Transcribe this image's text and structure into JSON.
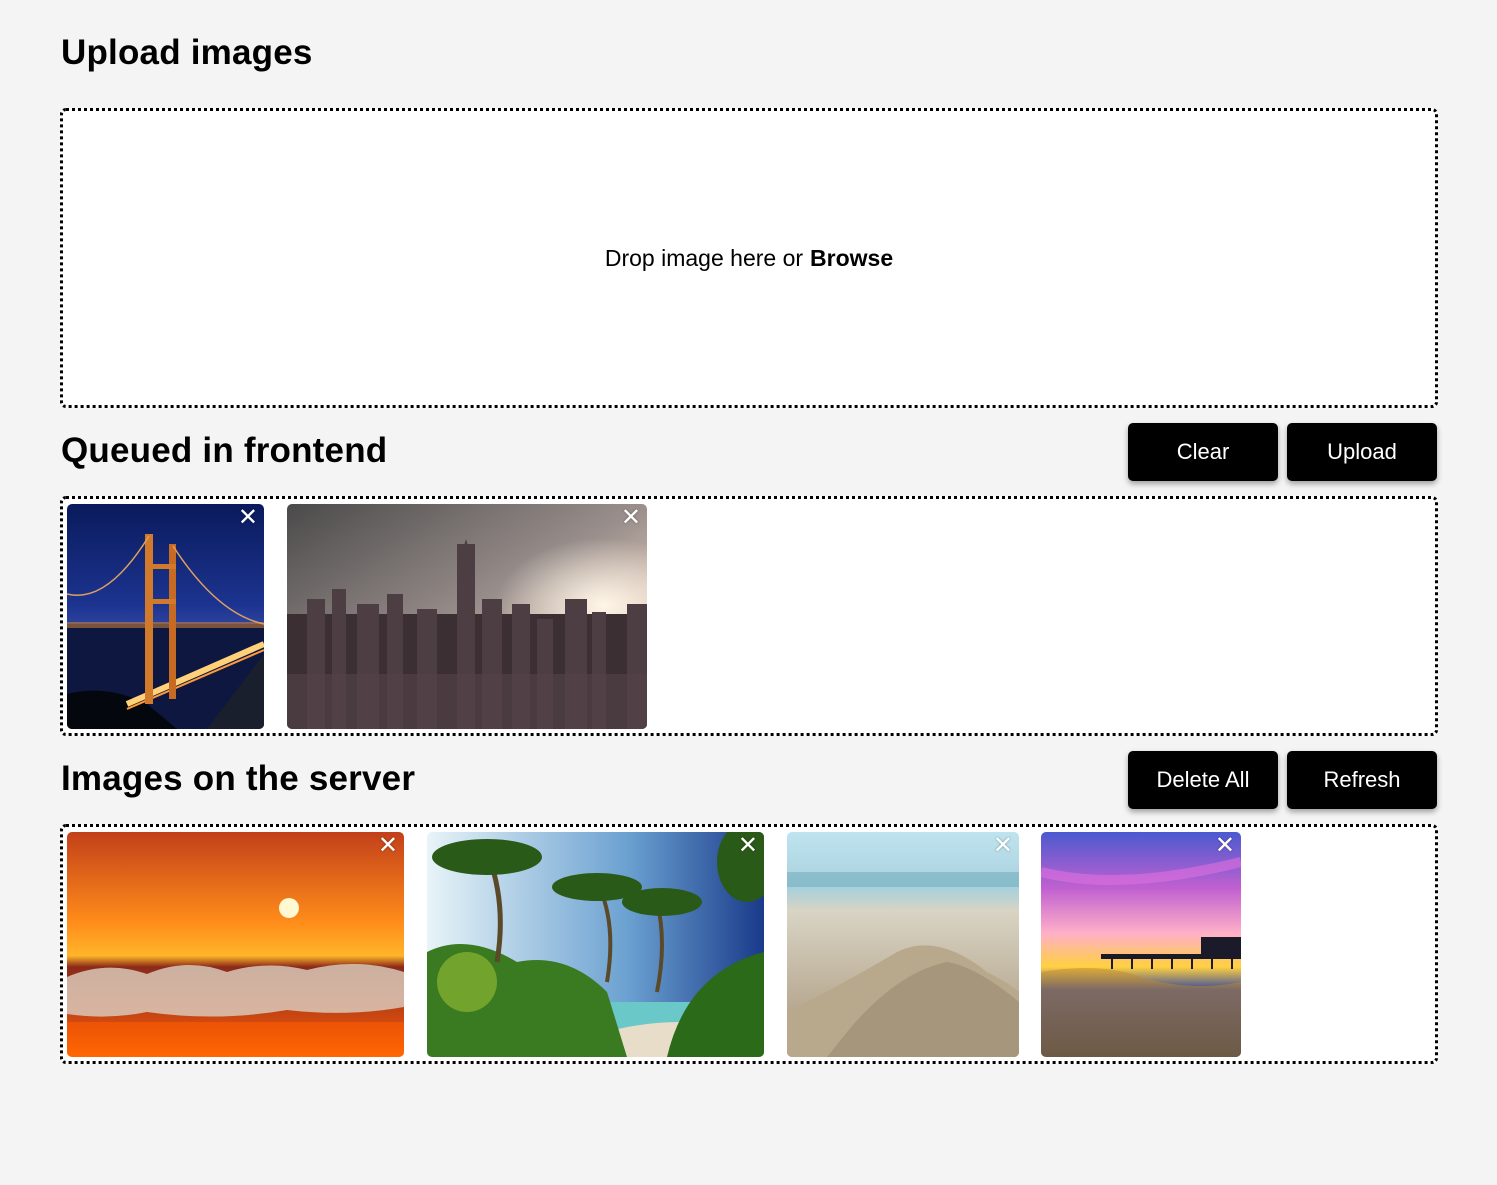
{
  "upload": {
    "title": "Upload images",
    "drop_text": "Drop image here or",
    "browse_label": "Browse"
  },
  "queued": {
    "title": "Queued in frontend",
    "clear_label": "Clear",
    "upload_label": "Upload",
    "items": [
      {
        "name": "golden-gate-bridge-night",
        "close": "✕"
      },
      {
        "name": "new-york-skyline-sunset",
        "close": "✕"
      }
    ]
  },
  "server": {
    "title": "Images on the server",
    "delete_all_label": "Delete All",
    "refresh_label": "Refresh",
    "items": [
      {
        "name": "ocean-sunset",
        "close": "✕"
      },
      {
        "name": "tropical-palm-beach",
        "close": "✕"
      },
      {
        "name": "sand-closeup",
        "close": "✕"
      },
      {
        "name": "pier-sunset",
        "close": "✕"
      }
    ]
  }
}
